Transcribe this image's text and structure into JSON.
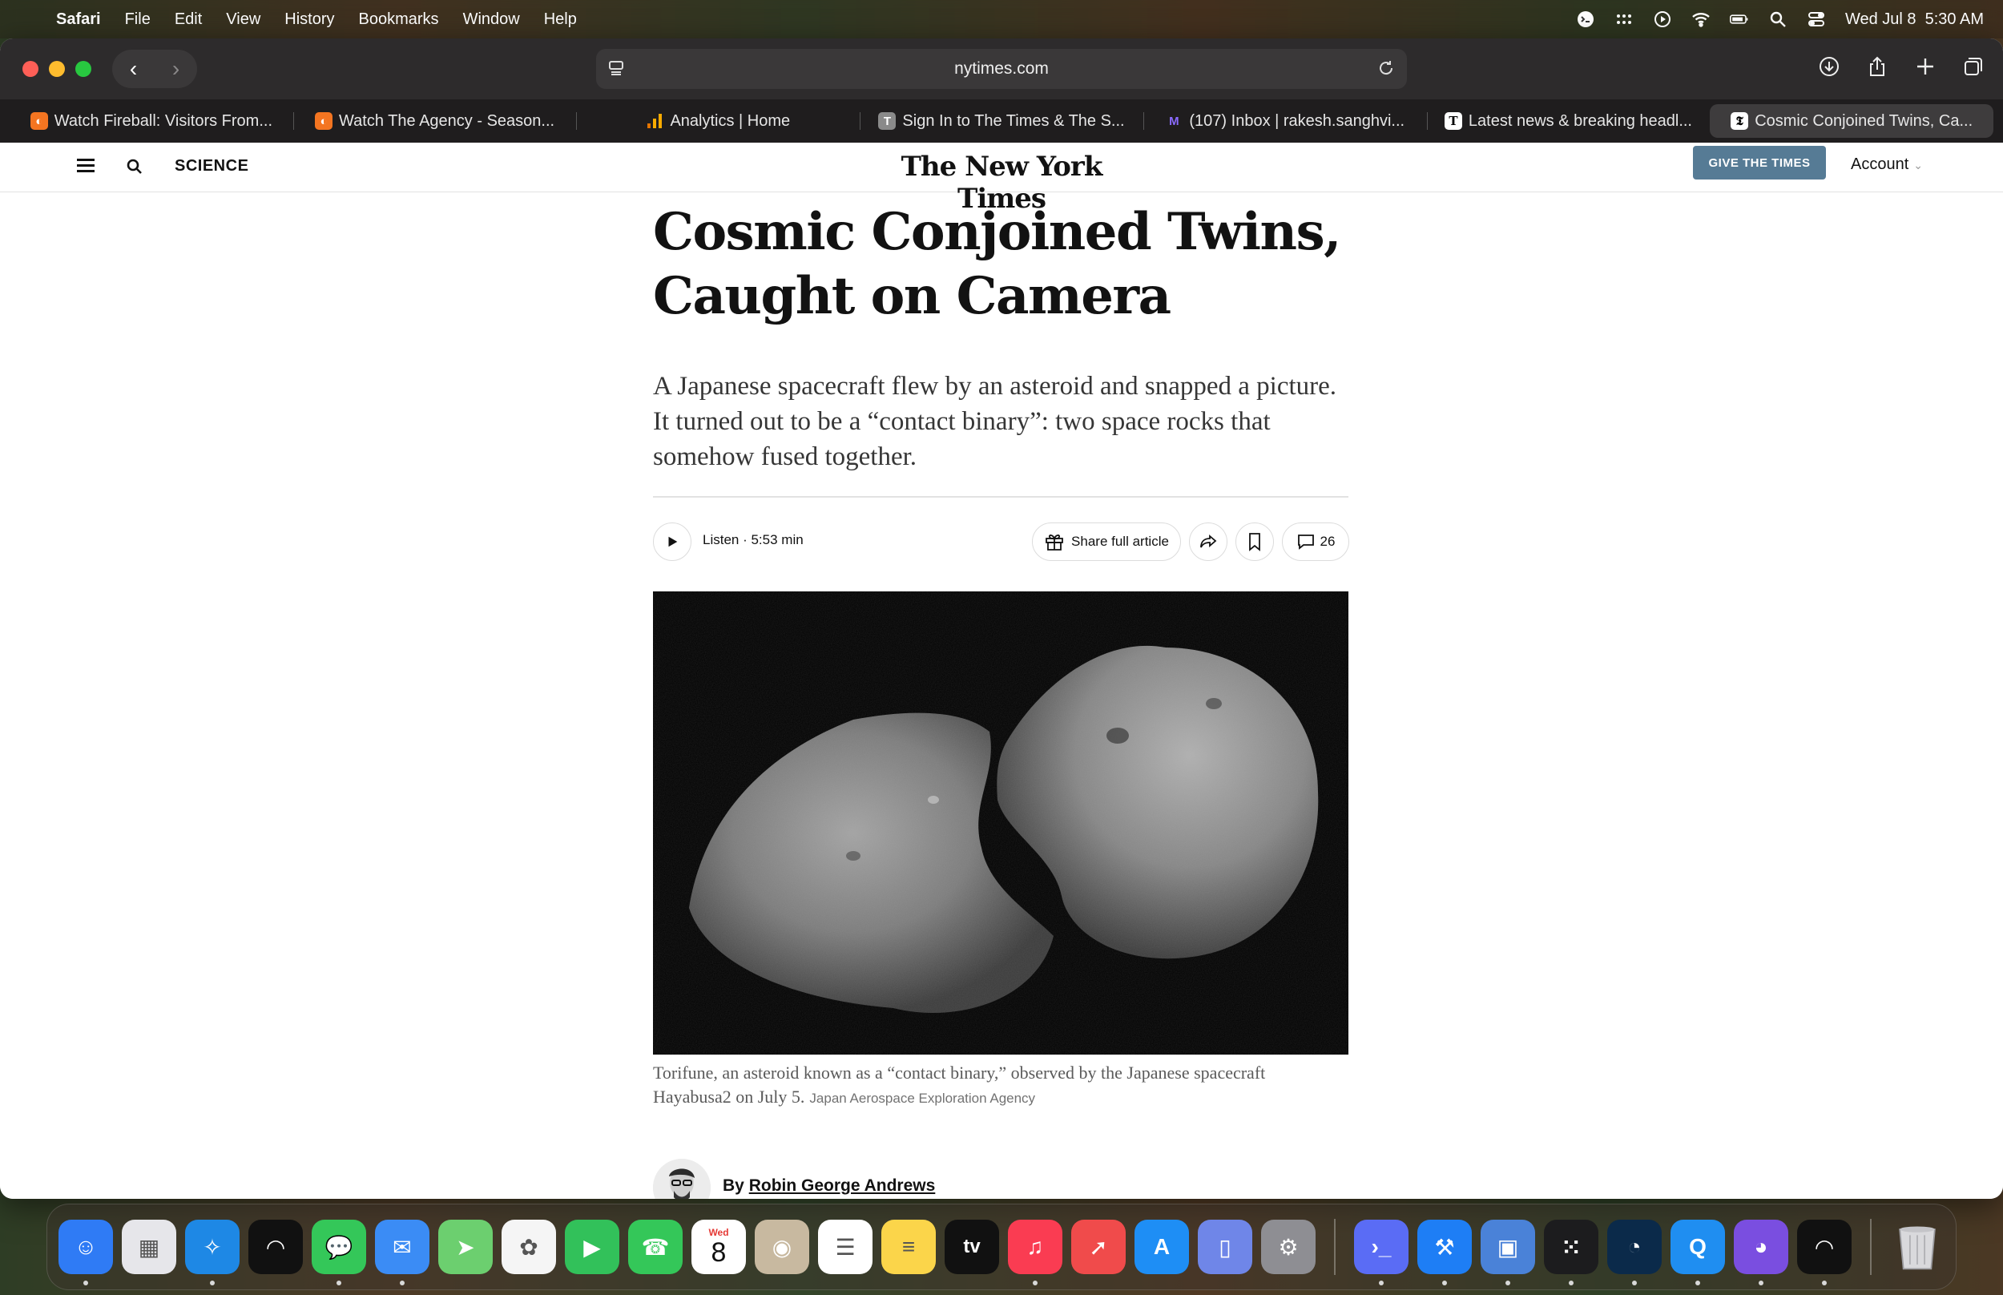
{
  "menubar": {
    "app_name": "Safari",
    "items": [
      "File",
      "Edit",
      "View",
      "History",
      "Bookmarks",
      "Window",
      "Help"
    ],
    "clock": "Wed Jul 8  5:30 AM"
  },
  "browser": {
    "url": "nytimes.com",
    "tabs": [
      {
        "title": "Watch Fireball: Visitors From...",
        "icon": "crunchyroll-like-icon",
        "color": "#f47521"
      },
      {
        "title": "Watch The Agency - Season...",
        "icon": "crunchyroll-like-icon",
        "color": "#f47521"
      },
      {
        "title": "Analytics | Home",
        "icon": "analytics-icon",
        "color": "#f9ab00"
      },
      {
        "title": "Sign In to The Times & The S...",
        "icon": "times-t-icon",
        "color": "#8a8a8a"
      },
      {
        "title": "(107) Inbox | rakesh.sanghvi...",
        "icon": "proton-mail-icon",
        "color": "#6d4aff"
      },
      {
        "title": "Latest news & breaking headl...",
        "icon": "times-t-icon",
        "color": "#ffffff"
      },
      {
        "title": "Cosmic Conjoined Twins, Ca...",
        "icon": "nyt-icon",
        "color": "#ffffff",
        "active": true
      }
    ]
  },
  "nyt": {
    "section": "SCIENCE",
    "logo": "The New York Times",
    "give_button": "GIVE THE TIMES",
    "account": "Account"
  },
  "article": {
    "headline_line1": "Cosmic Conjoined Twins,",
    "headline_line2": "Caught on Camera",
    "summary": "A Japanese spacecraft flew by an asteroid and snapped a picture. It turned out to be a “contact binary”: two space rocks that somehow fused together.",
    "listen_label": "Listen · 5:53 min",
    "share_label": "Share full article",
    "comment_count": "26",
    "caption": "Torifune, an asteroid known as a “contact binary,” observed by the Japanese spacecraft Hayabusa2 on July 5.",
    "credit": "Japan Aerospace Exploration Agency",
    "byline_prefix": "By",
    "author": "Robin George Andrews"
  },
  "dock": {
    "apps": [
      {
        "name": "finder-icon",
        "color": "#2f7bf5",
        "running": true
      },
      {
        "name": "launchpad-icon",
        "color": "#e6e6ea"
      },
      {
        "name": "safari-icon",
        "color": "#1e88e5",
        "running": true
      },
      {
        "name": "app-wave-icon",
        "color": "#111111"
      },
      {
        "name": "messages-icon",
        "color": "#34c759",
        "running": true
      },
      {
        "name": "mail-icon",
        "color": "#3b8cf5",
        "running": true
      },
      {
        "name": "maps-icon",
        "color": "#6ccf6f"
      },
      {
        "name": "photos-icon",
        "color": "#f5f5f5"
      },
      {
        "name": "facetime-icon",
        "color": "#32c15a"
      },
      {
        "name": "phone-icon",
        "color": "#34c759"
      },
      {
        "name": "calendar-icon",
        "color": "#ffffff"
      },
      {
        "name": "contacts-icon",
        "color": "#c8b9a0"
      },
      {
        "name": "reminders-icon",
        "color": "#ffffff"
      },
      {
        "name": "notes-icon",
        "color": "#fbd54a"
      },
      {
        "name": "apple-tv-icon",
        "color": "#111111"
      },
      {
        "name": "music-icon",
        "color": "#fa3c52",
        "running": true
      },
      {
        "name": "rocket-icon",
        "color": "#f04b4b"
      },
      {
        "name": "app-store-icon",
        "color": "#1e8ef5"
      },
      {
        "name": "simulator-icon",
        "color": "#6f86e8"
      },
      {
        "name": "system-settings-icon",
        "color": "#8e8e93"
      },
      {
        "name": "terminal-chat-icon",
        "color": "#5a6cf5",
        "running": true
      },
      {
        "name": "xcode-icon",
        "color": "#1e7ef5",
        "running": true
      },
      {
        "name": "database-icon",
        "color": "#4a82d8",
        "running": true
      },
      {
        "name": "grid-app-icon",
        "color": "#1c1c1e",
        "running": true
      },
      {
        "name": "speedometer-icon",
        "color": "#0b2a4a",
        "running": true
      },
      {
        "name": "qspace-icon",
        "color": "#1f8ef1",
        "running": true
      },
      {
        "name": "github-icon",
        "color": "#7a4ee0",
        "running": true
      },
      {
        "name": "app-wave-2-icon",
        "color": "#111111",
        "running": true
      }
    ],
    "calendar_day": "8",
    "calendar_weekday": "Wed",
    "calendar_label": "tv"
  }
}
